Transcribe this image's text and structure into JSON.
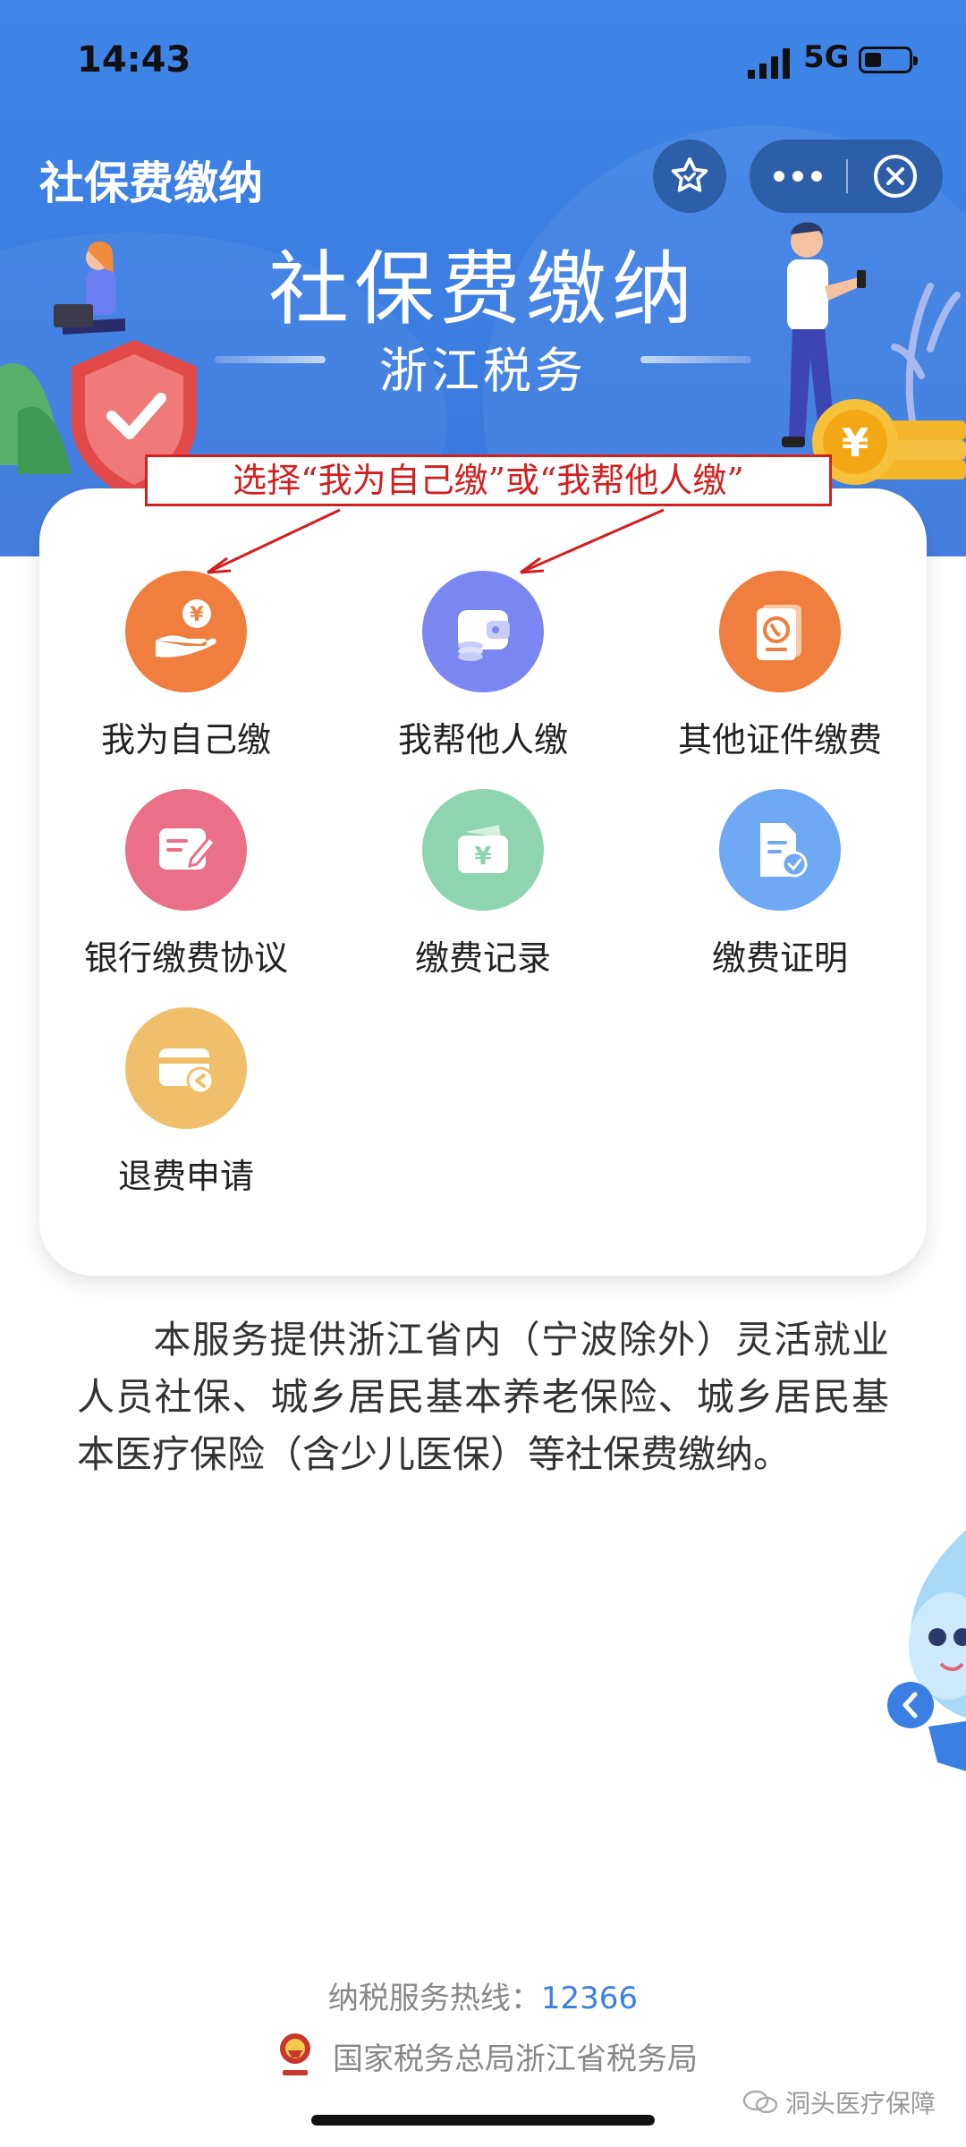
{
  "status_bar": {
    "time": "14:43",
    "network": "5G"
  },
  "header": {
    "app_title": "社保费缴纳",
    "banner_title": "社保费缴纳",
    "banner_subtitle": "浙江税务"
  },
  "annotation": {
    "text": "选择“我为自己缴”或“我帮他人缴”",
    "color": "#d21f1f"
  },
  "menu": {
    "items": [
      {
        "label": "我为自己缴",
        "icon": "hand-coin-icon",
        "color": "#f07e3f"
      },
      {
        "label": "我帮他人缴",
        "icon": "wallet-icon",
        "color": "#7b87f0"
      },
      {
        "label": "其他证件缴费",
        "icon": "passport-icon",
        "color": "#f07e3f"
      },
      {
        "label": "银行缴费协议",
        "icon": "edit-document-icon",
        "color": "#ea7088"
      },
      {
        "label": "缴费记录",
        "icon": "wallet-yuan-icon",
        "color": "#8ed4b0"
      },
      {
        "label": "缴费证明",
        "icon": "certificate-icon",
        "color": "#6fa8f3"
      },
      {
        "label": "退费申请",
        "icon": "card-refund-icon",
        "color": "#f0bf6c"
      }
    ]
  },
  "description": "本服务提供浙江省内（宁波除外）灵活就业人员社保、城乡居民基本养老保险、城乡居民基本医疗保险（含少儿医保）等社保费缴纳。",
  "footer": {
    "hotline_label": "纳税服务热线：",
    "hotline_number": "12366",
    "organization": "国家税务总局浙江省税务局"
  },
  "watermark": "洞头医疗保障",
  "colors": {
    "header_blue": "#3c7fe3",
    "capsule": "#2d5ea8"
  }
}
